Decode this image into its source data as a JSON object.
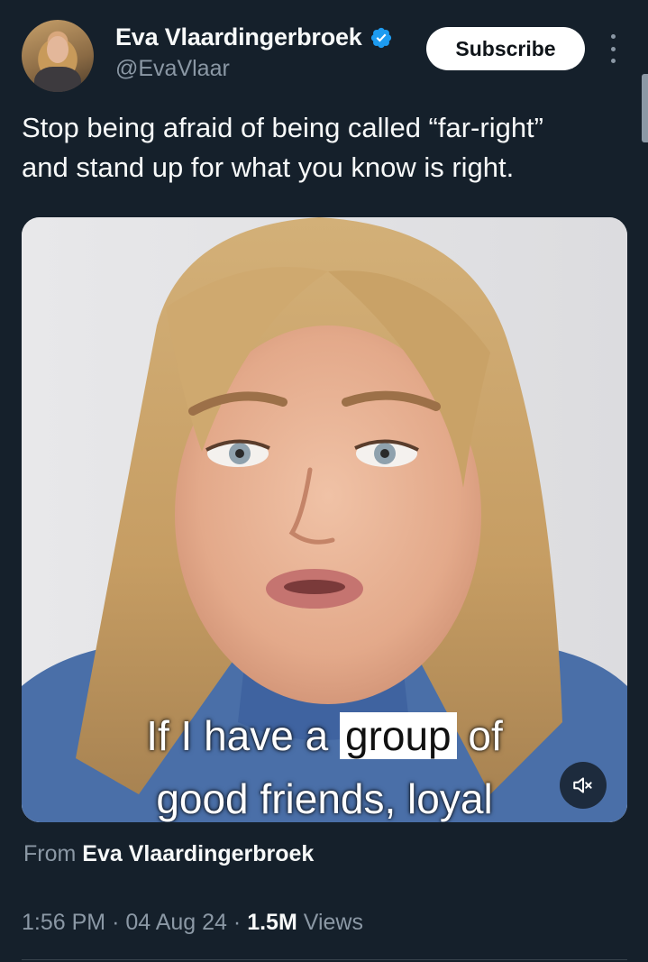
{
  "author": {
    "display_name": "Eva Vlaardingerbroek",
    "handle": "@EvaVlaar",
    "verified_icon": "verified-badge-icon",
    "badge_color": "#1d9bf0"
  },
  "header": {
    "subscribe_label": "Subscribe",
    "more_icon": "more-vertical-icon"
  },
  "tweet": {
    "text_line_1": "Stop being afraid of being called “far-right”",
    "text_line_2": "and stand up for what you know is right."
  },
  "media": {
    "caption_line_1_before": "If I have a ",
    "caption_line_1_highlight": "group",
    "caption_line_1_after": " of",
    "caption_line_2": "good friends, loyal",
    "mute_icon": "muted-speaker-icon"
  },
  "attribution": {
    "from_label": "From",
    "from_name": "Eva Vlaardingerbroek"
  },
  "meta": {
    "time": "1:56 PM",
    "separator": "·",
    "date": "04 Aug 24",
    "views_count": "1.5M",
    "views_label": "Views"
  },
  "colors": {
    "background": "#15202b",
    "primary_text": "#f7f9f9",
    "secondary_text": "#8b98a5",
    "accent": "#1d9bf0"
  }
}
